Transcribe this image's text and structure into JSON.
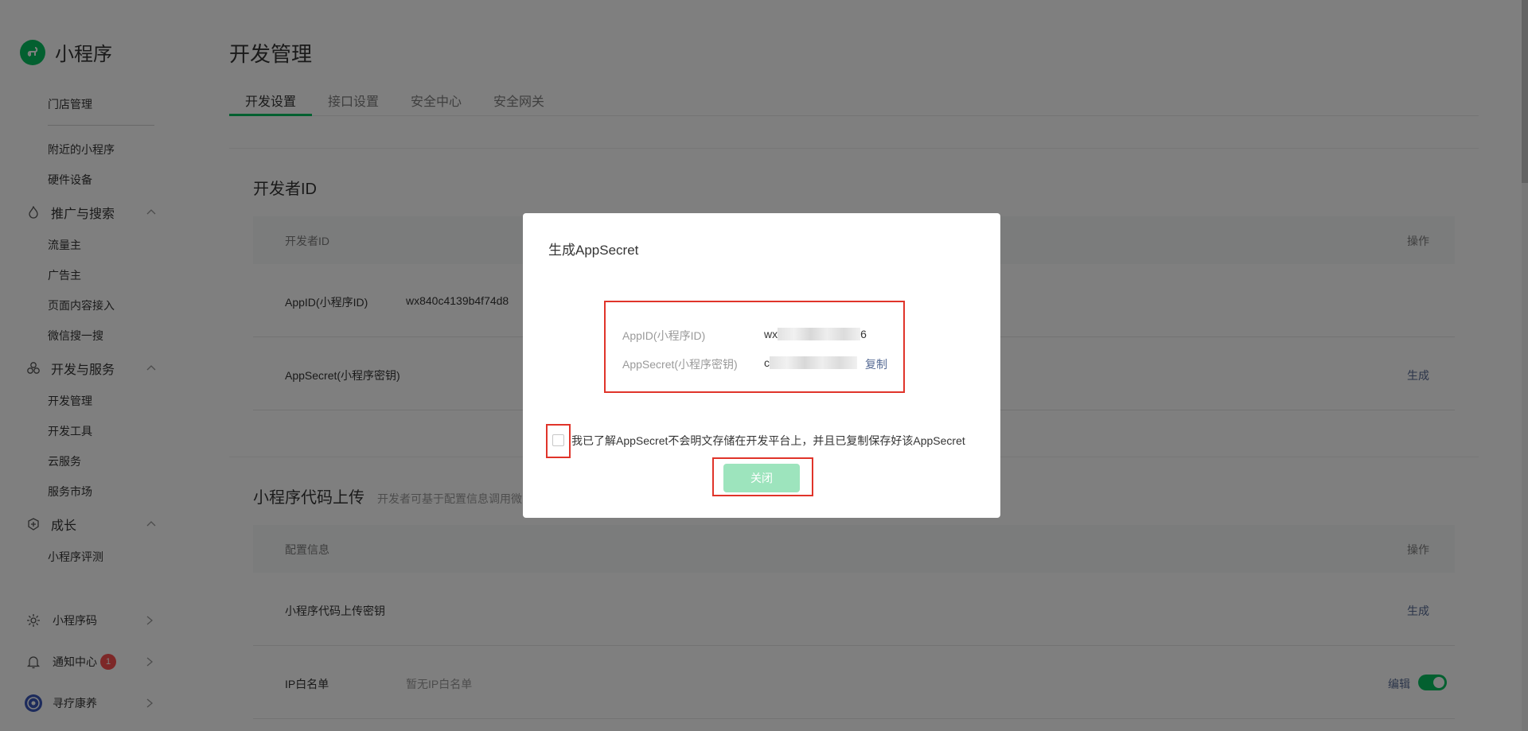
{
  "brand": {
    "title": "小程序",
    "logo_icon": "miniprogram-logo-icon"
  },
  "sidebar": {
    "items_top": [
      {
        "label": "门店管理"
      },
      {
        "label": "附近的小程序"
      },
      {
        "label": "硬件设备"
      }
    ],
    "groups": [
      {
        "label": "推广与搜索",
        "icon": "flame-icon",
        "children": [
          "流量主",
          "广告主",
          "页面内容接入",
          "微信搜一搜"
        ]
      },
      {
        "label": "开发与服务",
        "icon": "cubes-icon",
        "children": [
          "开发管理",
          "开发工具",
          "云服务",
          "服务市场"
        ]
      },
      {
        "label": "成长",
        "icon": "growth-icon",
        "children": [
          "小程序评测"
        ]
      }
    ],
    "bottom": [
      {
        "label": "小程序码",
        "icon": "qrcode-sun-icon"
      },
      {
        "label": "通知中心",
        "icon": "bell-icon",
        "badge": "1"
      },
      {
        "label": "寻疗康养",
        "icon": "account-avatar-icon"
      }
    ]
  },
  "header": {
    "title": "开发管理"
  },
  "tabs": [
    {
      "label": "开发设置",
      "active": true
    },
    {
      "label": "接口设置",
      "active": false
    },
    {
      "label": "安全中心",
      "active": false
    },
    {
      "label": "安全网关",
      "active": false
    }
  ],
  "developer_card": {
    "title": "开发者ID",
    "col_name": "开发者ID",
    "col_action": "操作",
    "rows": [
      {
        "name": "AppID(小程序ID)",
        "value": "wx840c4139b4f74d8",
        "action": ""
      },
      {
        "name": "AppSecret(小程序密钥)",
        "value": "",
        "action": "生成"
      }
    ]
  },
  "upload_card": {
    "title": "小程序代码上传",
    "subtitle": "开发者可基于配置信息调用微",
    "col_name": "配置信息",
    "col_action": "操作",
    "rows": [
      {
        "name": "小程序代码上传密钥",
        "value": "",
        "action": "生成"
      },
      {
        "name": "IP白名单",
        "value": "暂无IP白名单",
        "action": "编辑",
        "toggle_on": true
      }
    ]
  },
  "dialog": {
    "title": "生成AppSecret",
    "appid_label": "AppID(小程序ID)",
    "appid_prefix": "wx",
    "appid_suffix": "6",
    "secret_label": "AppSecret(小程序密钥)",
    "secret_prefix": "c",
    "copy_label": "复制",
    "ack_text": "我已了解AppSecret不会明文存储在开发平台上，并且已复制保存好该AppSecret",
    "checkbox_checked": false,
    "close_label": "关闭"
  },
  "colors": {
    "brand_green": "#07c160",
    "link_blue": "#576b95",
    "highlight_red": "#e0342a",
    "disabled_button": "#9de4bd",
    "badge_red": "#fa5151"
  }
}
